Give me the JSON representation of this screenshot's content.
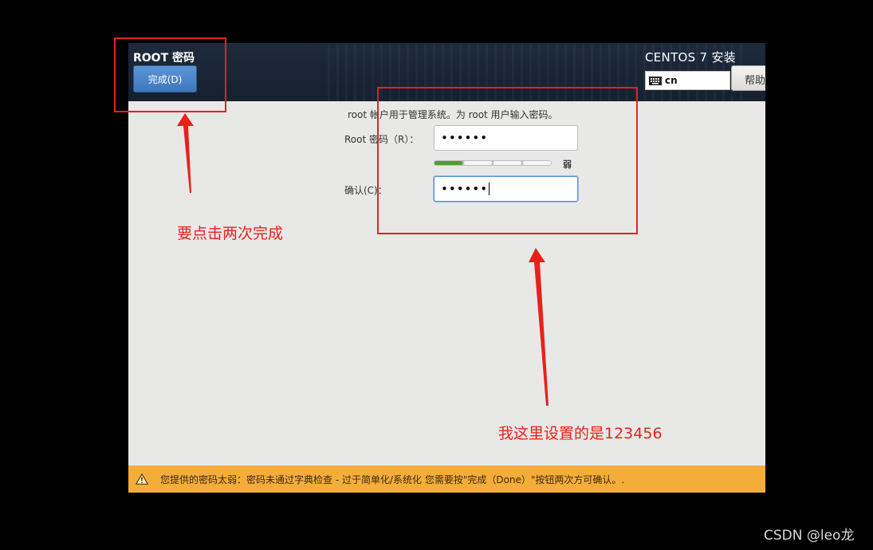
{
  "header": {
    "spoke_title": "ROOT 密码",
    "done_label": "完成(D)",
    "product_title": "CENTOS 7 安装",
    "keyboard_layout": "cn",
    "help_label": "帮助"
  },
  "form": {
    "description": "root 帐户用于管理系统。为 root 用户输入密码。",
    "root_password_label": "Root 密码（R）：",
    "root_password_value": "••••••",
    "confirm_label": "确认(C)：",
    "confirm_value": "••••••",
    "strength_label": "弱",
    "strength_level": 0.25
  },
  "warning": {
    "text": "您提供的密码太弱：密码未通过字典检查 - 过于简单化/系统化 您需要按\"完成（Done）\"按钮两次方可确认。.",
    "color": "#f5ad3a"
  },
  "annotations": {
    "note_done": "要点击两次完成",
    "note_password": "我这里设置的是123456",
    "color": "#e8211a"
  },
  "watermark": "CSDN @leo龙"
}
